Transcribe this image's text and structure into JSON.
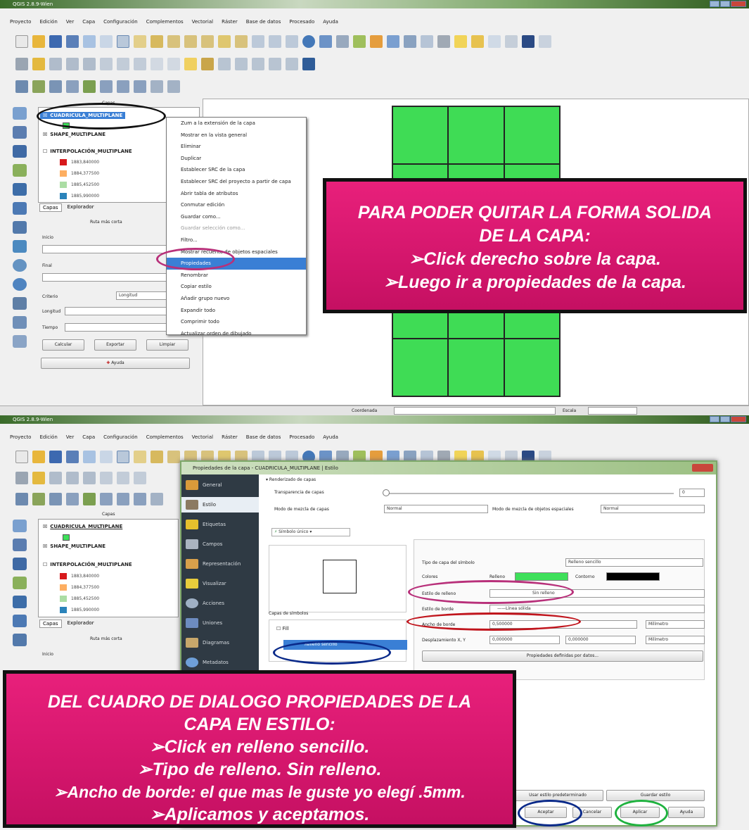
{
  "window_title": "QGIS 2.8.9-Wien",
  "menu": [
    "Proyecto",
    "Edición",
    "Ver",
    "Capa",
    "Configuración",
    "Complementos",
    "Vectorial",
    "Ráster",
    "Base de datos",
    "Procesado",
    "Ayuda"
  ],
  "layers_panel": {
    "title": "Capas",
    "layers": [
      "CUADRICULA_MULTIPLANE",
      "SHAPE_MULTIPLANE",
      "INTERPOLACIÓN_MULTIPLANE"
    ],
    "legend": [
      {
        "label": "1883,840000",
        "color": "#d7191c"
      },
      {
        "label": "1884,377500",
        "color": "#fdae61"
      },
      {
        "label": "1885,452500",
        "color": "#abdda4"
      },
      {
        "label": "1885,990000",
        "color": "#2b83ba"
      }
    ],
    "tabs": [
      "Capas",
      "Explorador"
    ]
  },
  "route_panel": {
    "title": "Ruta más corta",
    "start_label": "Inicio",
    "end_label": "Final",
    "criterion_label": "Criterio",
    "criterion_value": "Longitud",
    "length_label": "Longitud",
    "time_label": "Tiempo",
    "calc_button": "Calcular",
    "export_button": "Exportar",
    "clear_button": "Limpiar",
    "help_button": "Ayuda"
  },
  "context_menu": {
    "items": [
      "Zum a la extensión de la capa",
      "Mostrar en la vista general",
      "Eliminar",
      "Duplicar",
      "Establecer SRC de la capa",
      "Establecer SRC del proyecto a partir de capa",
      "Abrir tabla de atributos",
      "Conmutar edición",
      "Guardar como...",
      "Guardar selección como...",
      "Filtro...",
      "Mostrar recuento de objetos espaciales",
      "Propiedades",
      "Renombrar",
      "Copiar estilo",
      "Añadir grupo nuevo",
      "Expandir todo",
      "Comprimir todo",
      "Actualizar orden de dibujado"
    ],
    "selected_index": 12
  },
  "status_bar": {
    "coordinate_label": "Coordenada",
    "scale_label": "Escala"
  },
  "callout_top": {
    "lines": [
      "PARA PODER QUITAR LA FORMA SOLIDA",
      "DE LA CAPA:",
      "➢Click derecho sobre la capa.",
      "➢Luego ir a propiedades de la capa."
    ]
  },
  "dialog": {
    "title": "Propiedades de la capa - CUADRICULA_MULTIPLANE | Estilo",
    "sidebar": [
      "General",
      "Estilo",
      "Etiquetas",
      "Campos",
      "Representación",
      "Visualizar",
      "Acciones",
      "Uniones",
      "Diagramas",
      "Metadatos"
    ],
    "section_title": "Renderizado de capas",
    "transparency_label": "Transparencia de capas",
    "transparency_value": "0",
    "blend_label": "Modo de mezcla de capas",
    "blend_value": "Normal",
    "feature_blend_label": "Modo de mezcla de objetos espaciales",
    "feature_blend_value": "Normal",
    "renderer": "Símbolo único",
    "symbol_layers_label": "Capas de símbolos",
    "symbol_tree": [
      "Fill",
      "Relleno sencillo"
    ],
    "symbol_type_label": "Tipo de capa del símbolo",
    "symbol_type_value": "Relleno sencillo",
    "colors_label": "Colores",
    "fill_label": "Relleno",
    "border_label": "Contorno",
    "fill_color": "#3ee05a",
    "border_color": "#000000",
    "fill_style_label": "Estilo de relleno",
    "fill_style_value": "Sin relleno",
    "border_style_label": "Estilo de borde",
    "border_style_value": "Línea sólida",
    "border_width_label": "Ancho de borde",
    "border_width_value": "0,500000",
    "border_width_unit": "Milímetro",
    "offset_label": "Desplazamiento X, Y",
    "offset_x": "0,000000",
    "offset_y": "0,000000",
    "offset_unit": "Milímetro",
    "data_defined_button": "Propiedades definidas por datos...",
    "default_style_button": "Usar estilo predeterminado",
    "save_style_button": "Guardar estilo",
    "ok_button": "Aceptar",
    "cancel_button": "Cancelar",
    "apply_button": "Aplicar",
    "help_button": "Ayuda"
  },
  "callout_bottom": {
    "lines": [
      "DEL CUADRO DE DIALOGO PROPIEDADES DE LA",
      "CAPA EN ESTILO:",
      "➢Click en relleno sencillo.",
      "➢Tipo de relleno. Sin relleno.",
      "➢Ancho de borde: el que mas le guste yo elegí .5mm.",
      "➢Aplicamos y aceptamos."
    ]
  },
  "colors": {
    "callout": "#d4166c",
    "highlight": "#3a7fd5",
    "ellipse_black": "#111111",
    "ellipse_magenta": "#b8307a",
    "ellipse_red": "#c0141c",
    "ellipse_blue": "#0a2a8a",
    "ellipse_green": "#1fb23f"
  }
}
